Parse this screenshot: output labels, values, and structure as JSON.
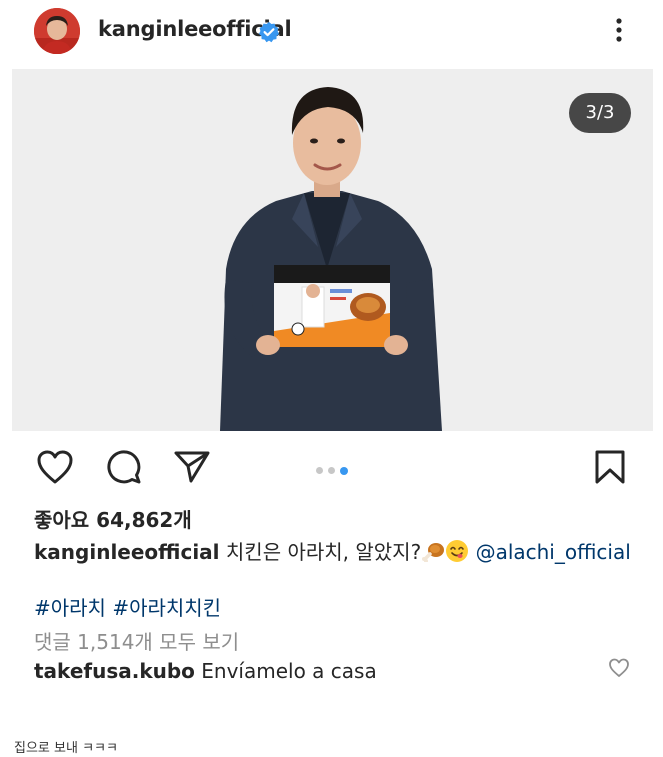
{
  "header": {
    "username": "kanginleeofficial",
    "verified": true
  },
  "post": {
    "slide_counter": "3/3",
    "slide_count": 3,
    "active_slide_index": 2,
    "likes_text": "좋아요 64,862개",
    "caption": {
      "username": "kanginleeofficial",
      "text": "치킨은 아라치, 알았지?",
      "mention": "@alachi_official"
    },
    "hashtags": "#아라치 #아라치치킨",
    "view_comments": "댓글 1,514개 모두 보기",
    "comment": {
      "username": "takefusa.kubo",
      "text": "Envíamelo a casa"
    }
  },
  "footer_caption": "집으로 보내 ㅋㅋㅋ",
  "colors": {
    "verified_blue": "#3897f0",
    "link_blue": "#00376b",
    "muted_gray": "#8e8e8e",
    "photo_bg": "#eeeeee"
  }
}
